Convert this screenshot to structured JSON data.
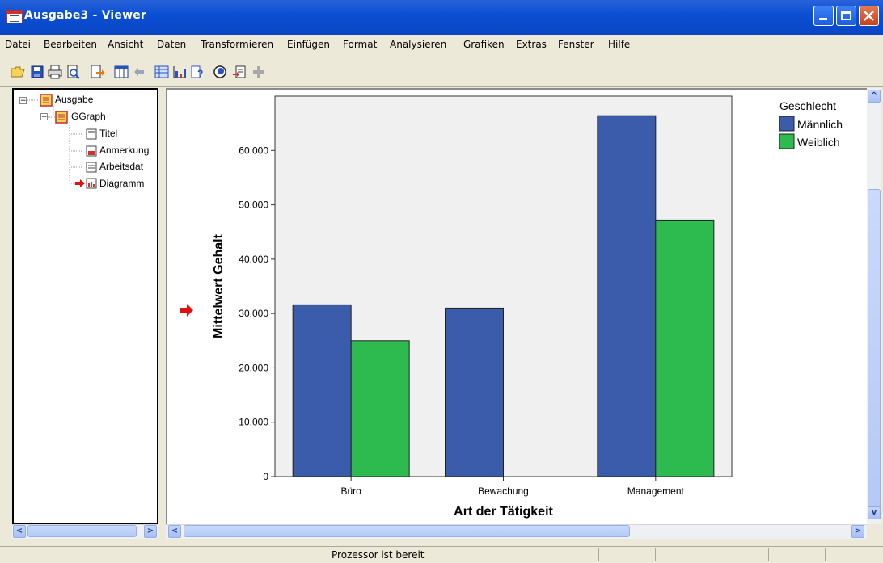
{
  "window": {
    "title": "Ausgabe3 - Viewer",
    "title_color": "#0b4fd4"
  },
  "menu": [
    "Datei",
    "Bearbeiten",
    "Ansicht",
    "Daten",
    "Transformieren",
    "Einfügen",
    "Format",
    "Analysieren",
    "Grafiken",
    "Extras",
    "Fenster",
    "Hilfe"
  ],
  "toolbar": {
    "icons": [
      "open-icon",
      "save-icon",
      "print-icon",
      "print-preview-icon",
      "export-icon",
      "goto-data-icon",
      "undo-icon",
      "pivot-table-icon",
      "chart-icon",
      "help-icon",
      "show-hide-icon",
      "insert-output-icon",
      "expand-icon"
    ]
  },
  "outline": {
    "items": [
      "Ausgabe",
      "GGraph",
      "Titel",
      "Anmerkung",
      "Arbeitsdat",
      "Diagramm"
    ]
  },
  "status": {
    "text": "Prozessor ist bereit"
  },
  "chart_data": {
    "type": "bar",
    "title": "",
    "xlabel": "Art der Tätigkeit",
    "ylabel": "Mittelwert Gehalt",
    "categories": [
      "Büro",
      "Bewachung",
      "Management"
    ],
    "series": [
      {
        "name": "Männlich",
        "color": "#3a5cab",
        "values": [
          31600,
          31000,
          66400
        ]
      },
      {
        "name": "Weiblich",
        "color": "#2dba4e",
        "values": [
          25000,
          null,
          47200
        ]
      }
    ],
    "legend_title": "Geschlecht",
    "legend_position": "top-right",
    "ylim": [
      0,
      70000
    ],
    "yticks": [
      "0",
      "10.000",
      "20.000",
      "30.000",
      "40.000",
      "50.000",
      "60.000"
    ],
    "ytick_values": [
      0,
      10000,
      20000,
      30000,
      40000,
      50000,
      60000
    ],
    "plot_background": "#f0f0f0"
  }
}
